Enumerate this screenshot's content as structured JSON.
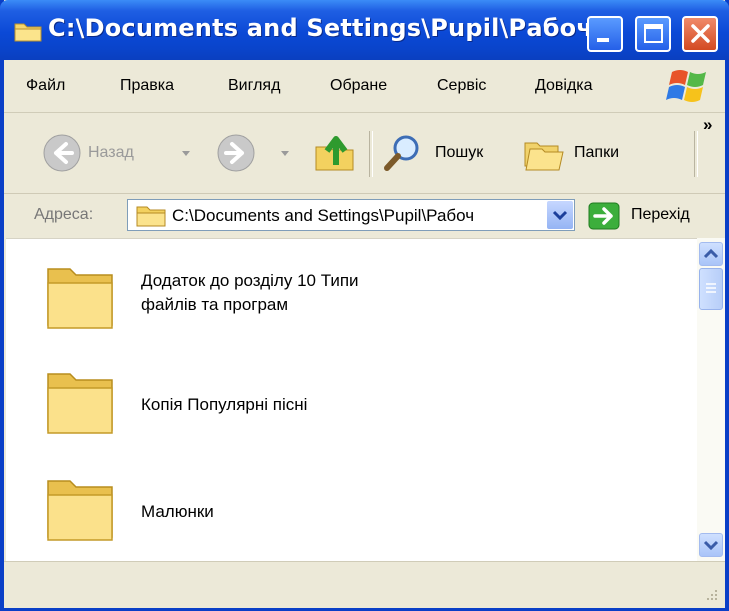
{
  "window": {
    "title": "C:\\Documents and Settings\\Pupil\\Рабоч...",
    "titlebar_color": "#0a45cc"
  },
  "menubar": {
    "items": [
      "Файл",
      "Правка",
      "Вигляд",
      "Обране",
      "Сервіс",
      "Довідка"
    ]
  },
  "toolbar": {
    "back_label": "Назад",
    "search_label": "Пошук",
    "folders_label": "Папки",
    "more_glyph": "»"
  },
  "address": {
    "label": "Адреса:",
    "value": "C:\\Documents and Settings\\Pupil\\Рабоч",
    "go_label": "Перехід"
  },
  "folders": [
    {
      "name_line1": "Додаток до розділу 10 Типи",
      "name_line2": "файлів та програм",
      "icon": "folder-icon"
    },
    {
      "name_line1": "Копія Популярні пісні",
      "name_line2": "",
      "icon": "folder-icon"
    },
    {
      "name_line1": "Малюнки",
      "name_line2": "",
      "icon": "folder-icon"
    }
  ]
}
